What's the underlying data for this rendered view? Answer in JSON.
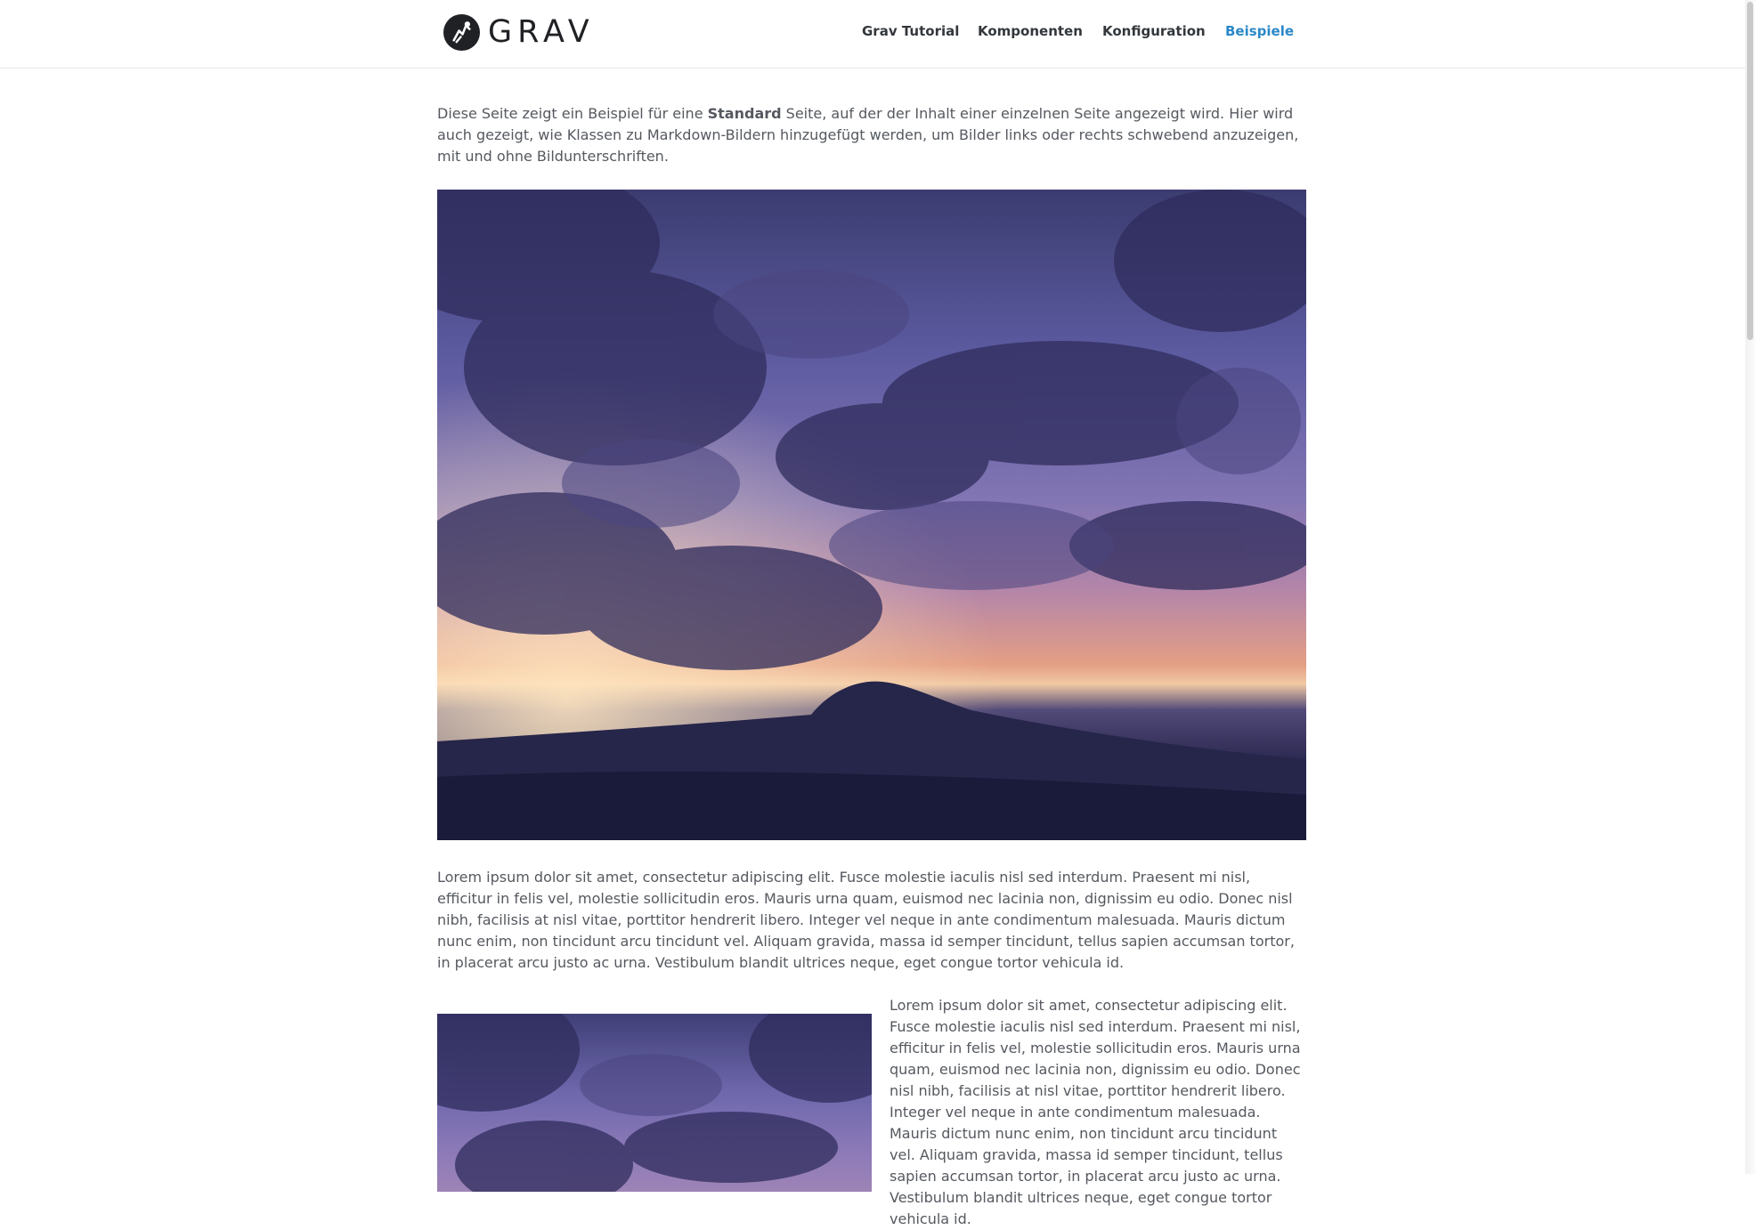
{
  "header": {
    "logo_text": "GRAV",
    "nav": [
      {
        "label": "Grav Tutorial",
        "active": false
      },
      {
        "label": "Komponenten",
        "active": false
      },
      {
        "label": "Konfiguration",
        "active": false
      },
      {
        "label": "Beispiele",
        "active": true
      }
    ]
  },
  "content": {
    "intro_before": "Diese Seite zeigt ein Beispiel für eine ",
    "intro_bold": "Standard",
    "intro_after": " Seite, auf der der Inhalt einer einzelnen Seite angezeigt wird. Hier wird auch gezeigt, wie Klassen zu Markdown-Bildern hinzugefügt werden, um Bilder links oder rechts schwebend anzuzeigen, mit und ohne Bildunterschriften.",
    "paragraph": "Lorem ipsum dolor sit amet, consectetur adipiscing elit. Fusce molestie iaculis nisl sed interdum. Praesent mi nisl, efficitur in felis vel, molestie sollicitudin eros. Mauris urna quam, euismod nec lacinia non, dignissim eu odio. Donec nisl nibh, facilisis at nisl vitae, porttitor hendrerit libero. Integer vel neque in ante condimentum malesuada. Mauris dictum nunc enim, non tincidunt arcu tincidunt vel. Aliquam gravida, massa id semper tincidunt, tellus sapien accumsan tortor, in placerat arcu justo ac urna. Vestibulum blandit ultrices neque, eget congue tortor vehicula id.",
    "float_paragraph": "Lorem ipsum dolor sit amet, consectetur adipiscing elit. Fusce molestie iaculis nisl sed interdum. Praesent mi nisl, efficitur in felis vel, molestie sollicitudin eros. Mauris urna quam, euismod nec lacinia non, dignissim eu odio. Donec nisl nibh, facilisis at nisl vitae, porttitor hendrerit libero. Integer vel neque in ante condimentum malesuada. Mauris dictum nunc enim, non tincidunt arcu tincidunt vel. Aliquam gravida, massa id semper tincidunt, tellus sapien accumsan tortor, in placerat arcu justo ac urna. Vestibulum blandit ultrices neque, eget congue tortor vehicula id."
  },
  "colors": {
    "accent": "#2b88c8",
    "nav_text": "#33373b",
    "body_text": "#55595f"
  }
}
